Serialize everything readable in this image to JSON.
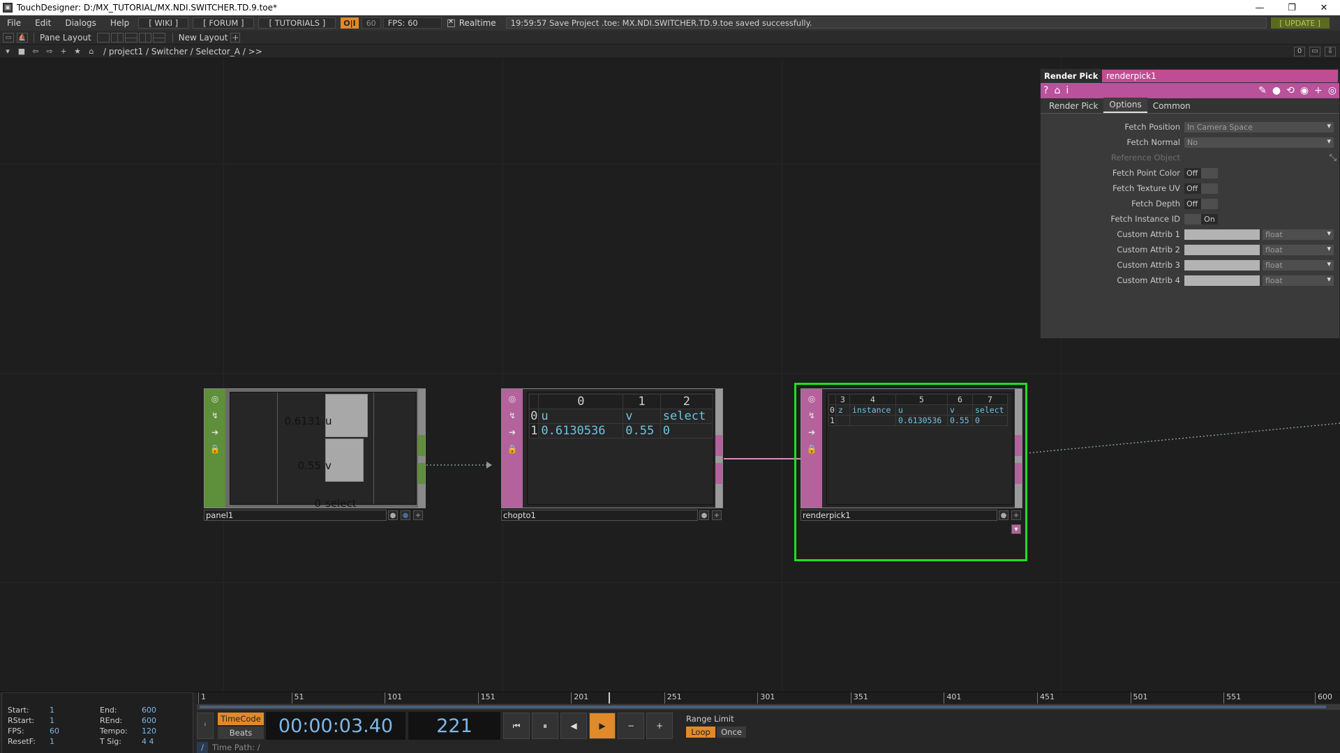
{
  "window": {
    "title": "TouchDesigner: D:/MX_TUTORIAL/MX.NDI.SWITCHER.TD.9.toe*",
    "controls": [
      "—",
      "❐",
      "✕"
    ]
  },
  "menubar": {
    "menus": [
      "File",
      "Edit",
      "Dialogs",
      "Help"
    ],
    "wiki": "[ WIKI ]",
    "forum": "[ FORUM ]",
    "tutorials": "[ TUTORIALS ]",
    "oi": "O|I",
    "fps_box": "60",
    "fps_label": "FPS:  60",
    "realtime": "Realtime",
    "status": "19:59:57 Save Project .toe: MX.NDI.SWITCHER.TD.9.toe saved successfully.",
    "update": "[ UPDATE ]"
  },
  "panebar": {
    "pane_layout": "Pane Layout",
    "new_layout": "New Layout"
  },
  "pathbar": {
    "path": "/ project1 / Switcher / Selector_A / >>",
    "right_value": "0"
  },
  "nodes": {
    "panel1": {
      "name": "panel1",
      "rows": [
        {
          "value": "0.6131",
          "label": "u",
          "fraction": 0.6131
        },
        {
          "value": "0.55",
          "label": "v",
          "fraction": 0.55
        },
        {
          "value": "0",
          "label": "select",
          "fraction": 0
        }
      ]
    },
    "chopto1": {
      "name": "chopto1",
      "headers": [
        "",
        "0",
        "1",
        "2"
      ],
      "rows": [
        [
          "0",
          "u",
          "v",
          "select"
        ],
        [
          "1",
          "0.6130536",
          "0.55",
          "0"
        ]
      ]
    },
    "renderpick1": {
      "name": "renderpick1",
      "headers": [
        "",
        "3",
        "4",
        "5",
        "6",
        "7"
      ],
      "rows": [
        [
          "0",
          "z",
          "instance",
          "u",
          "v",
          "select"
        ],
        [
          "1",
          "",
          "",
          "0.6130536",
          "0.55",
          "0"
        ]
      ]
    }
  },
  "params": {
    "op_type": "Render Pick",
    "op_name": "renderpick1",
    "tabs": [
      "Render Pick",
      "Options",
      "Common"
    ],
    "rows": [
      {
        "label": "Fetch Position",
        "kind": "menu",
        "value": "In Camera Space"
      },
      {
        "label": "Fetch Normal",
        "kind": "menu",
        "value": "No"
      },
      {
        "label": "Reference Object",
        "kind": "dim"
      },
      {
        "label": "Fetch Point Color",
        "kind": "toggle",
        "value": "Off"
      },
      {
        "label": "Fetch Texture UV",
        "kind": "toggle",
        "value": "Off"
      },
      {
        "label": "Fetch Depth",
        "kind": "toggle",
        "value": "Off"
      },
      {
        "label": "Fetch Instance ID",
        "kind": "toggle-on",
        "value": "On"
      },
      {
        "label": "Custom Attrib 1",
        "kind": "attrib",
        "value": "float"
      },
      {
        "label": "Custom Attrib 2",
        "kind": "attrib",
        "value": "float"
      },
      {
        "label": "Custom Attrib 3",
        "kind": "attrib",
        "value": "float"
      },
      {
        "label": "Custom Attrib 4",
        "kind": "attrib",
        "value": "float"
      }
    ]
  },
  "timeline": {
    "info": {
      "start_k": "Start:",
      "start_v": "1",
      "end_k": "End:",
      "end_v": "600",
      "rstart_k": "RStart:",
      "rstart_v": "1",
      "rend_k": "REnd:",
      "rend_v": "600",
      "fps_k": "FPS:",
      "fps_v": "60",
      "tempo_k": "Tempo:",
      "tempo_v": "120",
      "resetf_k": "ResetF:",
      "resetf_v": "1",
      "tsig_k": "T Sig:",
      "tsig_v": "4     4"
    },
    "ticks": [
      "1",
      "51",
      "101",
      "151",
      "201",
      "251",
      "301",
      "351",
      "401",
      "451",
      "501",
      "551",
      "600"
    ],
    "current_frame": 221,
    "frame_range": [
      1,
      600
    ],
    "timecode_btn": "TimeCode",
    "beats_btn": "Beats",
    "timecode": "00:00:03.40",
    "frame": "221",
    "range_limit": "Range Limit",
    "loop": "Loop",
    "once": "Once",
    "time_path": "Time Path: /"
  }
}
